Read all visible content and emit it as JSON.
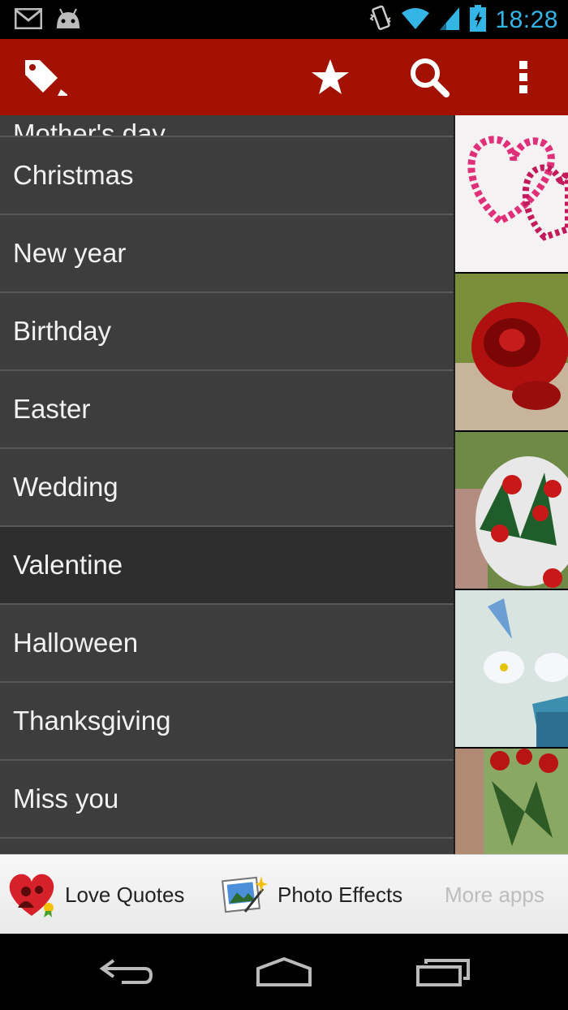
{
  "status_bar": {
    "time": "18:28",
    "icons": [
      "gmail-icon",
      "android-debug-icon",
      "vibrate-icon",
      "wifi-icon",
      "signal-icon",
      "battery-charging-icon"
    ]
  },
  "action_bar": {
    "background": "#a31100",
    "icons": [
      "tag-icon",
      "star-icon",
      "search-icon",
      "overflow-menu-icon"
    ]
  },
  "drawer": {
    "items": [
      {
        "label": "Mother's day"
      },
      {
        "label": "Christmas"
      },
      {
        "label": "New year"
      },
      {
        "label": "Birthday"
      },
      {
        "label": "Easter"
      },
      {
        "label": "Wedding"
      },
      {
        "label": "Valentine"
      },
      {
        "label": "Halloween"
      },
      {
        "label": "Thanksgiving"
      },
      {
        "label": "Miss you"
      }
    ],
    "selected": "Valentine"
  },
  "thumbnails": [
    "hearts-flower-image",
    "red-rose-image",
    "rose-bouquet-image",
    "white-flowers-image",
    "roses-vase-image"
  ],
  "promo_bar": {
    "love_quotes": "Love Quotes",
    "photo_effects": "Photo Effects",
    "more_apps": "More apps"
  },
  "nav_bar": {
    "icons": [
      "back-icon",
      "home-icon",
      "recent-apps-icon"
    ]
  }
}
